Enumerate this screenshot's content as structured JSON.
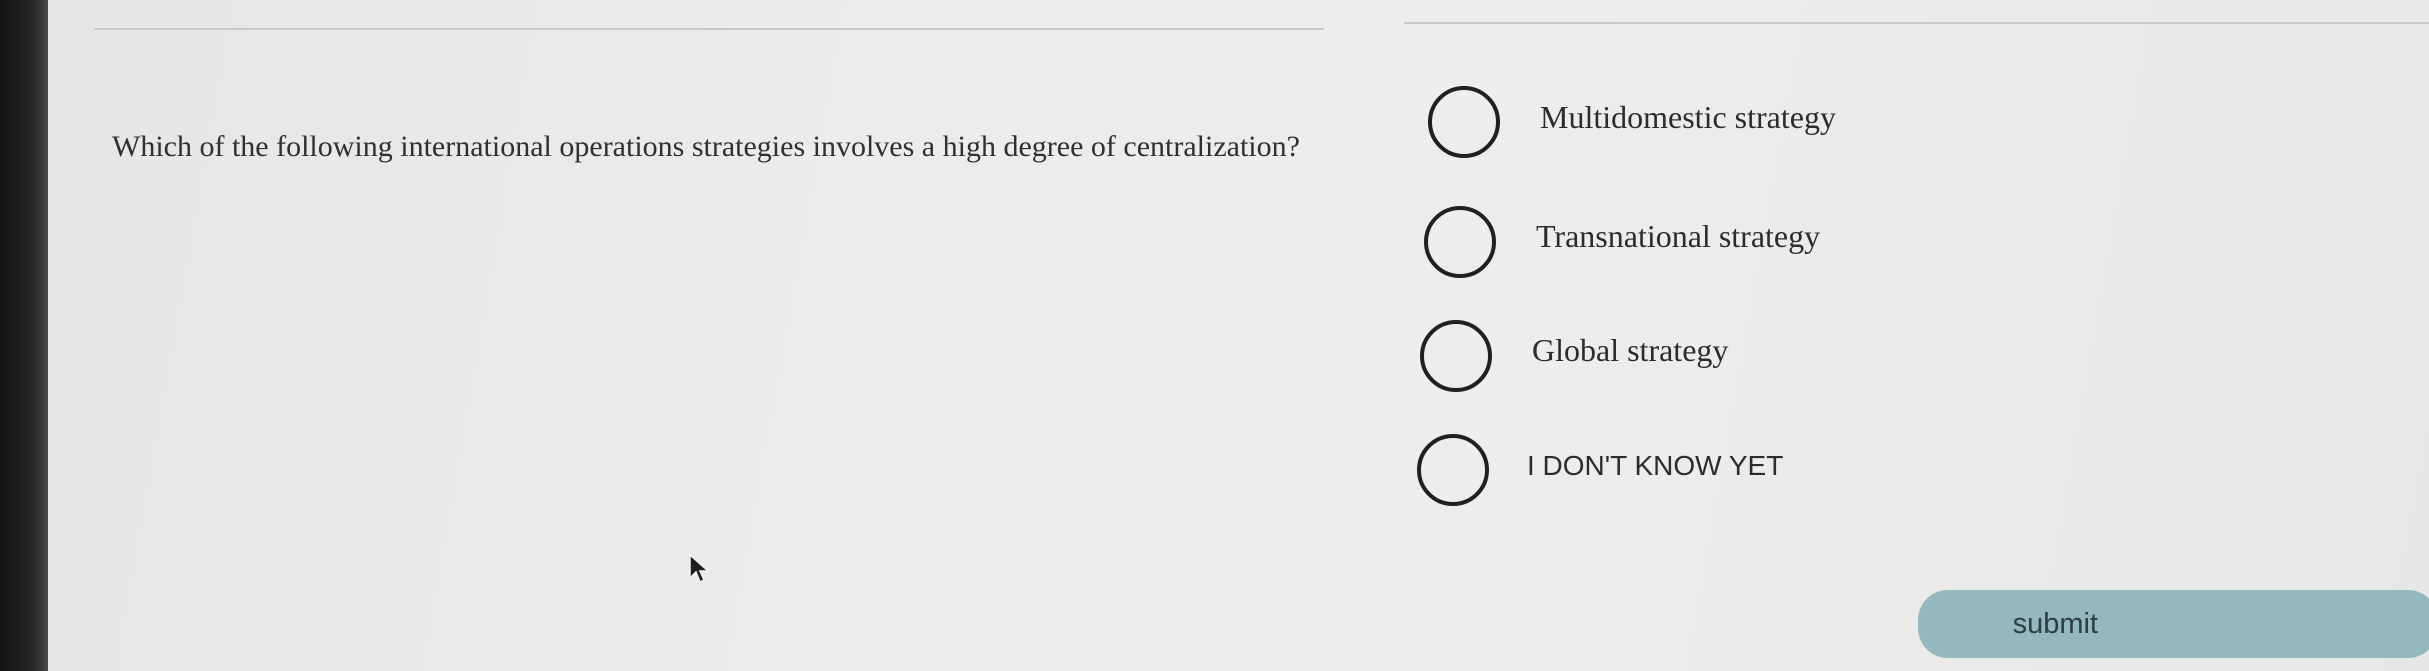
{
  "question": {
    "text": "Which of the following international operations strategies involves a high degree of centralization?"
  },
  "answers": [
    {
      "label": "Multidomestic strategy",
      "selected": false
    },
    {
      "label": "Transnational strategy",
      "selected": false
    },
    {
      "label": "Global strategy",
      "selected": false
    },
    {
      "label": "I DON'T KNOW YET",
      "selected": false
    }
  ],
  "submit": {
    "label": "submit"
  },
  "colors": {
    "submit_bg": "#94b7c0",
    "text": "#2f3033",
    "radio_border": "#1e2024"
  },
  "icons": [
    "radio-circle-icon",
    "mouse-pointer-icon"
  ]
}
